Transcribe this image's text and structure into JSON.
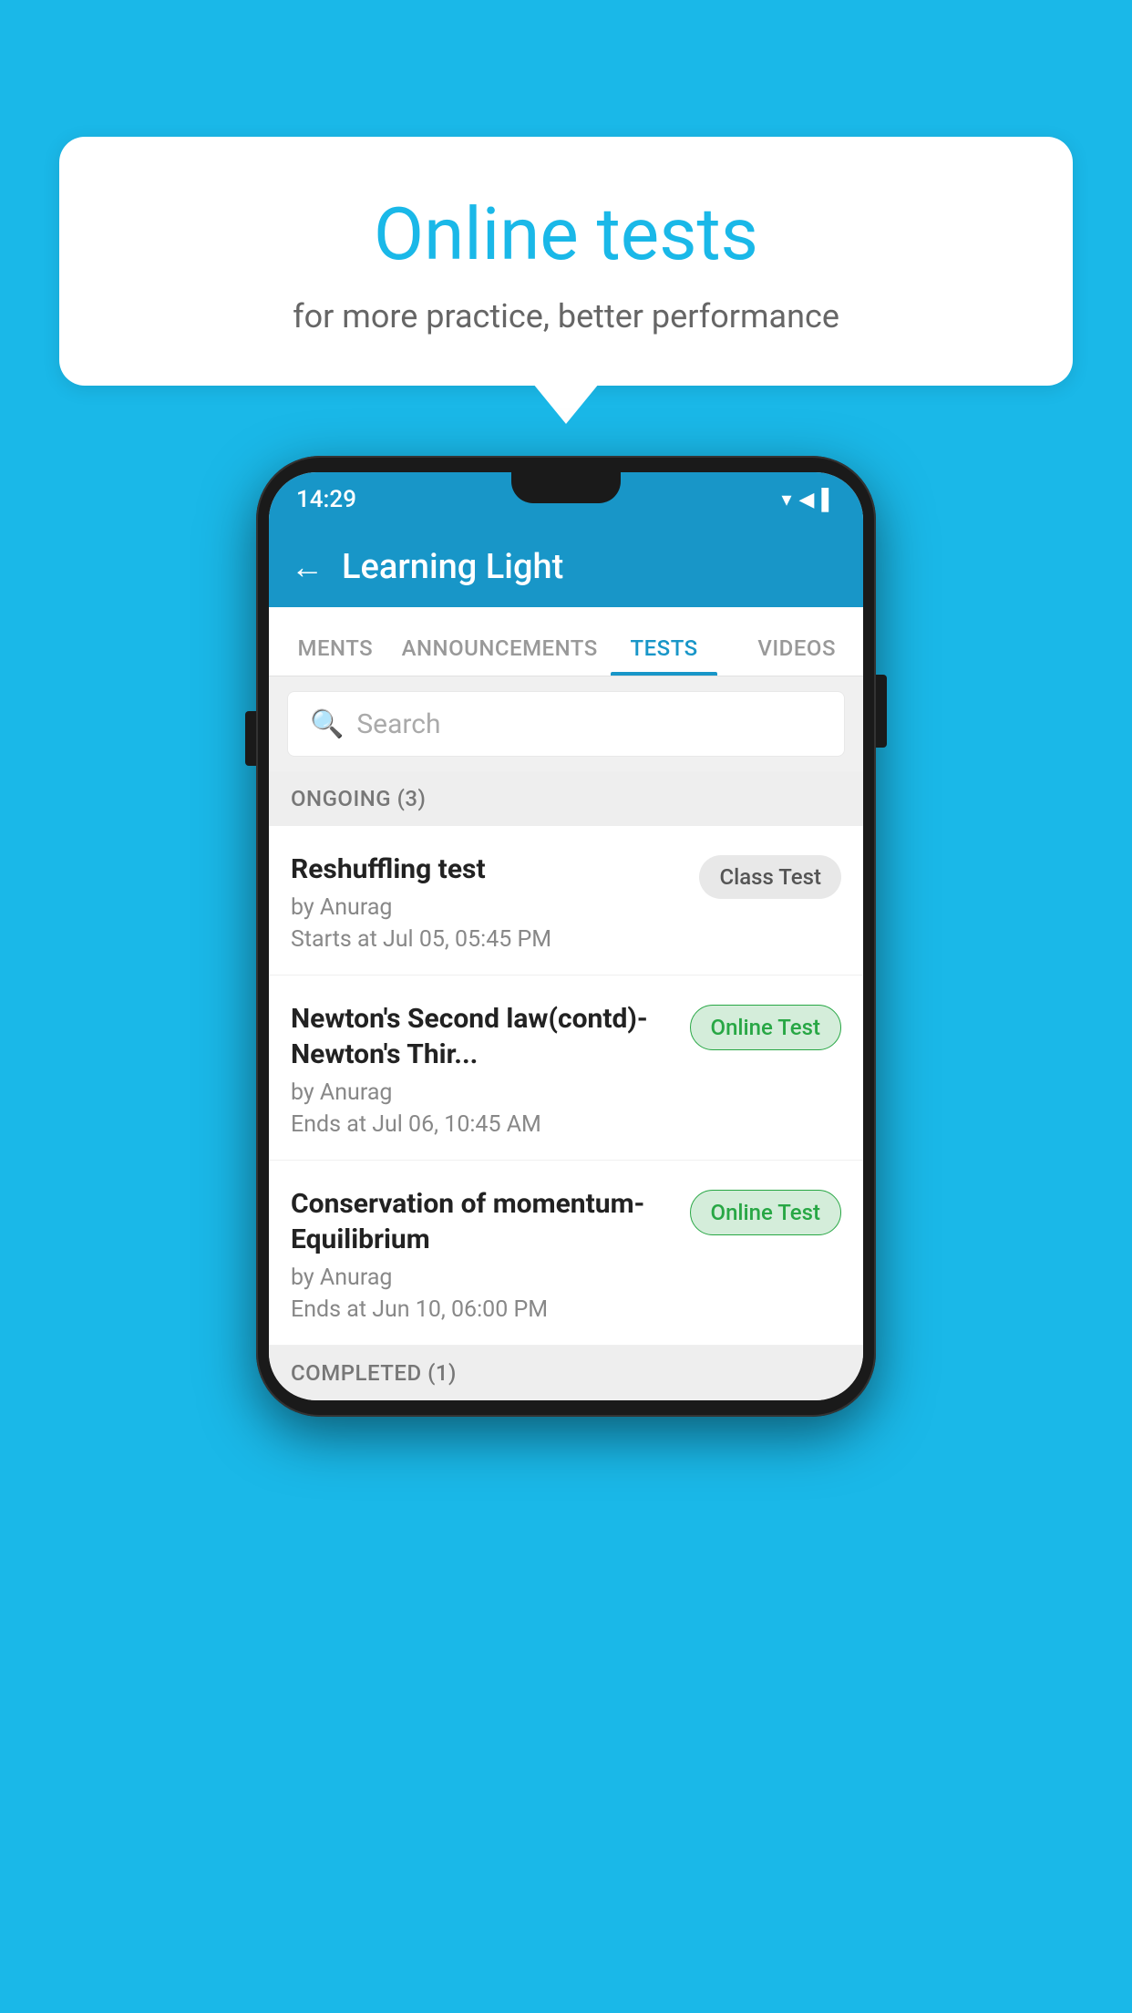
{
  "background_color": "#1ab8e8",
  "bubble": {
    "title": "Online tests",
    "subtitle": "for more practice, better performance"
  },
  "phone": {
    "status_bar": {
      "time": "14:29",
      "icons": "▾◀▌"
    },
    "app_bar": {
      "back_label": "←",
      "title": "Learning Light"
    },
    "tabs": [
      {
        "label": "MENTS",
        "active": false
      },
      {
        "label": "ANNOUNCEMENTS",
        "active": false
      },
      {
        "label": "TESTS",
        "active": true
      },
      {
        "label": "VIDEOS",
        "active": false
      }
    ],
    "search": {
      "placeholder": "Search"
    },
    "ongoing_section": {
      "header": "ONGOING (3)"
    },
    "tests": [
      {
        "name": "Reshuffling test",
        "by": "by Anurag",
        "date_label": "Starts at",
        "date": "Jul 05, 05:45 PM",
        "badge": "Class Test",
        "badge_type": "class"
      },
      {
        "name": "Newton's Second law(contd)-Newton's Thir...",
        "by": "by Anurag",
        "date_label": "Ends at",
        "date": "Jul 06, 10:45 AM",
        "badge": "Online Test",
        "badge_type": "online"
      },
      {
        "name": "Conservation of momentum-Equilibrium",
        "by": "by Anurag",
        "date_label": "Ends at",
        "date": "Jun 10, 06:00 PM",
        "badge": "Online Test",
        "badge_type": "online"
      }
    ],
    "completed_section": {
      "header": "COMPLETED (1)"
    }
  }
}
